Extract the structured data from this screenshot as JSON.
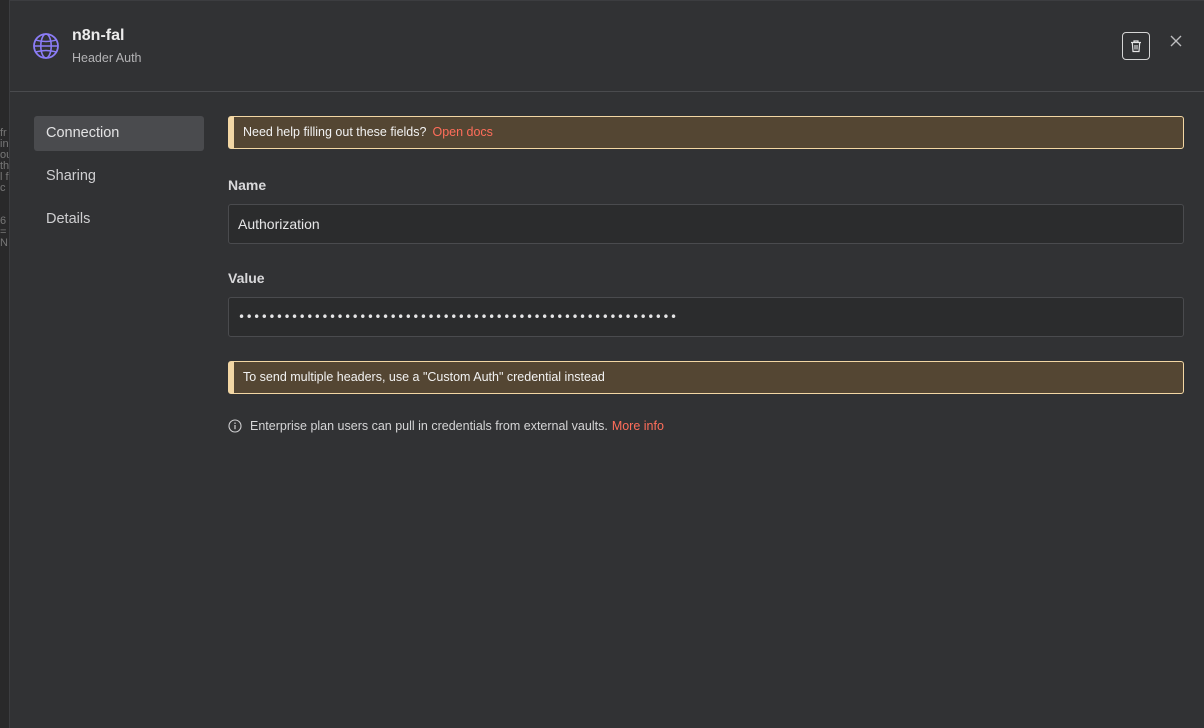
{
  "header": {
    "title": "n8n-fal",
    "subtitle": "Header Auth"
  },
  "sidebar": {
    "items": [
      {
        "label": "Connection",
        "active": true
      },
      {
        "label": "Sharing",
        "active": false
      },
      {
        "label": "Details",
        "active": false
      }
    ]
  },
  "help_notice": {
    "text": "Need help filling out these fields?",
    "link": "Open docs"
  },
  "fields": {
    "name": {
      "label": "Name",
      "value": "Authorization"
    },
    "value": {
      "label": "Value",
      "value": "••••••••••••••••••••••••••••••••••••••••••••••••••••••••••"
    }
  },
  "warning_notice": {
    "text": "To send multiple headers, use a \"Custom Auth\" credential instead"
  },
  "info": {
    "text": "Enterprise plan users can pull in credentials from external vaults.",
    "link": "More info"
  },
  "colors": {
    "accent": "#ff6d5a",
    "notice_bg": "#544633",
    "notice_border": "#f3d7a4",
    "icon_purple": "#8b7cf6"
  },
  "icons": {
    "header": "globe-icon",
    "delete": "trash-icon",
    "close": "close-icon",
    "info": "info-icon"
  }
}
